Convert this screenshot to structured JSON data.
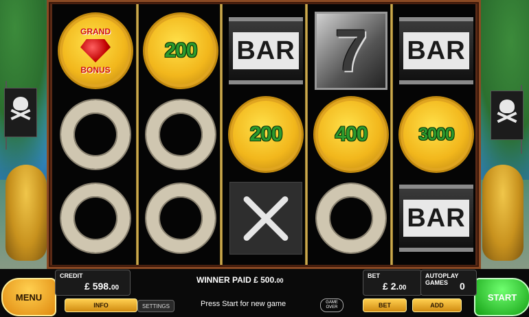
{
  "reels": [
    [
      {
        "kind": "grand",
        "top_text": "GRAND",
        "bottom_text": "BONUS",
        "icon": "ruby-icon"
      },
      {
        "kind": "ring",
        "icon": "ring-icon"
      },
      {
        "kind": "ring",
        "icon": "ring-icon"
      }
    ],
    [
      {
        "kind": "coin",
        "value": "200"
      },
      {
        "kind": "ring",
        "icon": "ring-icon"
      },
      {
        "kind": "ring",
        "icon": "ring-icon"
      }
    ],
    [
      {
        "kind": "bar",
        "label": "BAR"
      },
      {
        "kind": "coin",
        "value": "200"
      },
      {
        "kind": "bones",
        "icon": "crossed-bones-icon"
      }
    ],
    [
      {
        "kind": "seven",
        "label": "7"
      },
      {
        "kind": "coin",
        "value": "400"
      },
      {
        "kind": "ring",
        "icon": "ring-icon"
      }
    ],
    [
      {
        "kind": "bar",
        "label": "BAR"
      },
      {
        "kind": "coin",
        "value": "3000"
      },
      {
        "kind": "bar",
        "label": "BAR"
      }
    ]
  ],
  "panel": {
    "menu_label": "MENU",
    "start_label": "START",
    "credit": {
      "label": "CREDIT",
      "currency": "£",
      "main": "598.",
      "cents": "00"
    },
    "info_label": "INFO",
    "settings_label": "SETTINGS",
    "winner": {
      "text": "WINNER PAID £ 500.",
      "cents": "00"
    },
    "status_text": "Press Start for new game",
    "game_over": {
      "line1": "GAME",
      "line2": "OVER"
    },
    "bet": {
      "label": "BET",
      "currency": "£",
      "main": "2.",
      "cents": "00"
    },
    "bet_button": "BET",
    "autoplay": {
      "label": "AUTOPLAY GAMES",
      "value": "0"
    },
    "add_label": "ADD"
  },
  "colors": {
    "coin_text": "#2d9a2d",
    "menu": "#f2a82a",
    "start": "#22c022"
  }
}
